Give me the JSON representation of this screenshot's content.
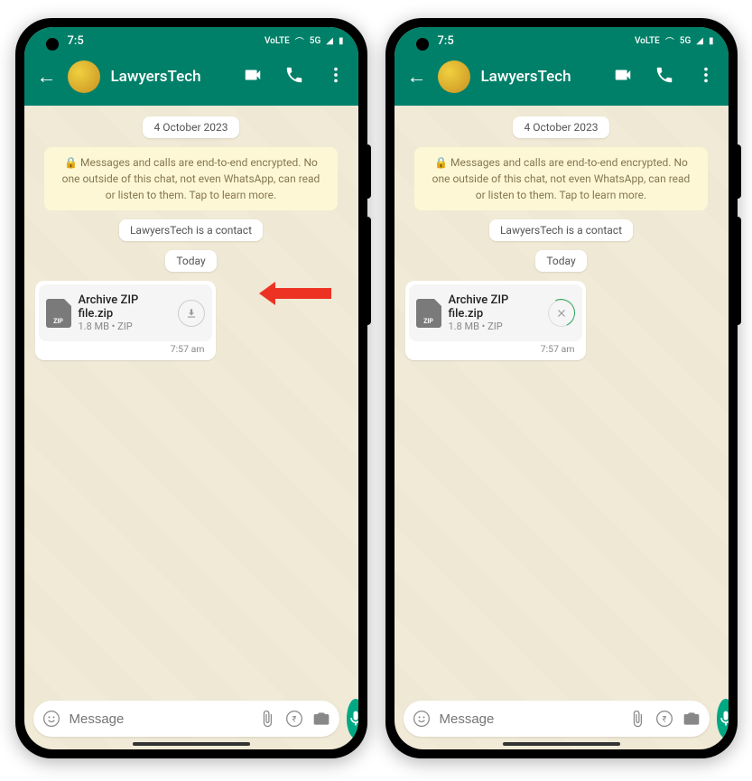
{
  "status": {
    "time": "7:5",
    "net": "5G"
  },
  "header": {
    "contact": "LawyersTech"
  },
  "chat": {
    "date": "4 October 2023",
    "encryption": "Messages and calls are end-to-end encrypted. No one outside of this chat, not even WhatsApp, can read or listen to them. Tap to learn more.",
    "contact_info": "LawyersTech is a contact",
    "today": "Today",
    "file": {
      "name": "Archive ZIP file.zip",
      "meta": "1.8 MB • ZIP",
      "badge": "ZIP",
      "time": "7:57 am"
    }
  },
  "input": {
    "placeholder": "Message"
  }
}
